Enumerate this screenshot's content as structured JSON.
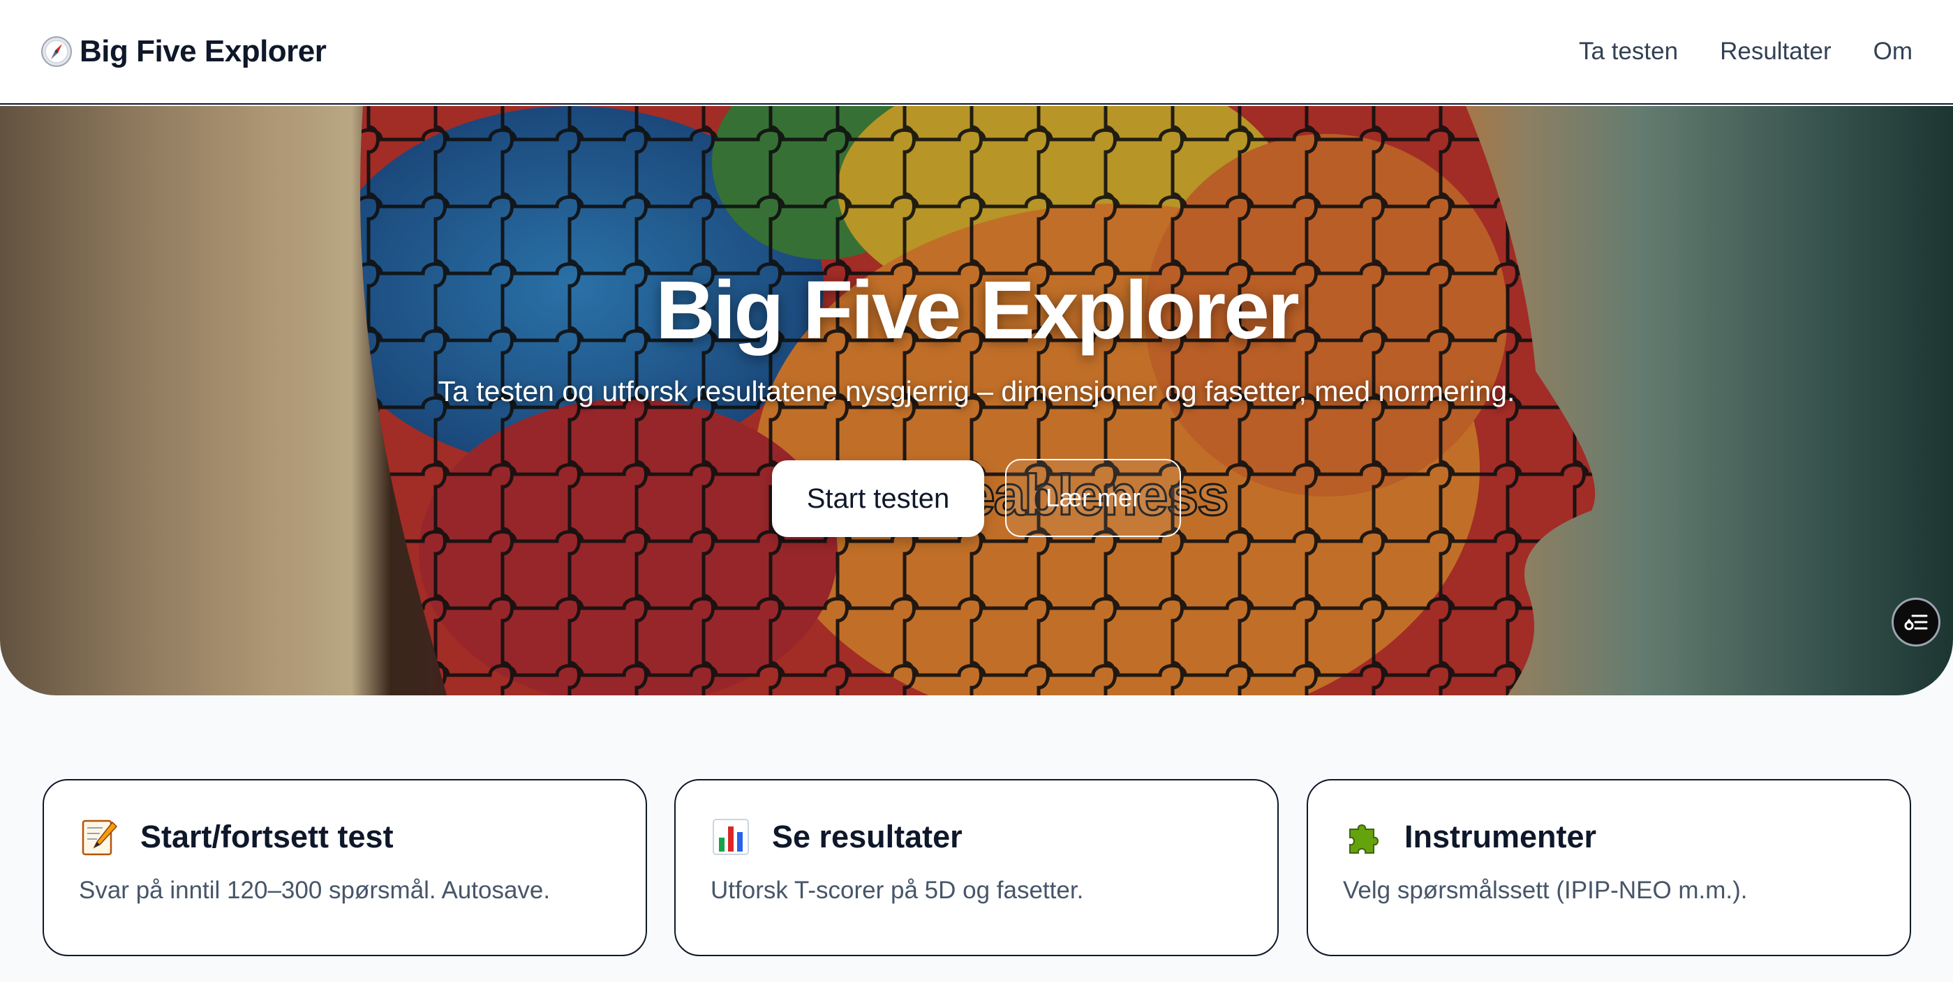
{
  "header": {
    "brand": "Big Five Explorer",
    "nav": [
      "Ta testen",
      "Resultater",
      "Om"
    ]
  },
  "hero": {
    "title": "Big Five Explorer",
    "subtitle": "Ta testen og utforsk resultatene nysgjerrig – dimensjoner og fasetter, med normering.",
    "primary_button": "Start testen",
    "secondary_button": "Lær mer",
    "background_word": "eableness"
  },
  "cards": [
    {
      "icon": "memo-pencil-icon",
      "title": "Start/fortsett test",
      "description": "Svar på inntil 120–300 spørsmål. Autosave."
    },
    {
      "icon": "bar-chart-icon",
      "title": "Se resultater",
      "description": "Utforsk T-scorer på 5D og fasetter."
    },
    {
      "icon": "puzzle-piece-icon",
      "title": "Instrumenter",
      "description": "Velg spørsmålssett (IPIP-NEO m.m.)."
    }
  ],
  "colors": {
    "text_dark": "#0f172a",
    "text_muted": "#475569",
    "page_bg": "#f8fafc"
  }
}
